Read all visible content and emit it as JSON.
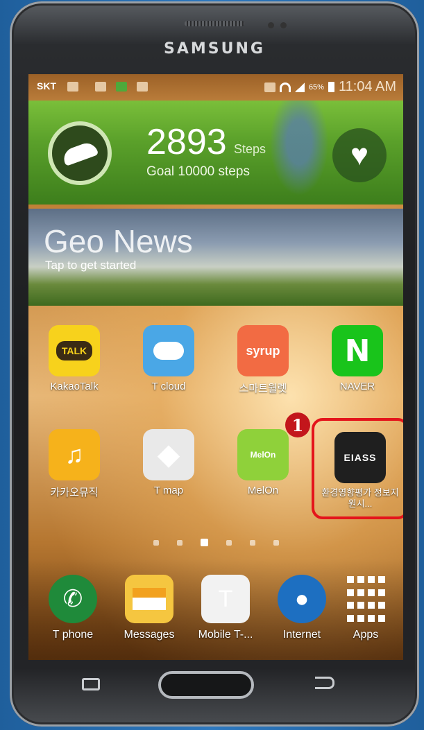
{
  "device": {
    "brand": "SAMSUNG"
  },
  "status_bar": {
    "carrier": "SKT",
    "battery": "65%",
    "time": "11:04 AM"
  },
  "health_widget": {
    "steps": "2893",
    "steps_unit": "Steps",
    "goal": "Goal 10000 steps"
  },
  "news_widget": {
    "title": "Geo News",
    "subtitle": "Tap to get started"
  },
  "home_apps": [
    {
      "label": "KakaoTalk",
      "icon": "kakaotalk-icon",
      "glyph": "TALK"
    },
    {
      "label": "T cloud",
      "icon": "tcloud-icon",
      "glyph": ""
    },
    {
      "label": "스마트월렛",
      "icon": "syrup-icon",
      "glyph": "syrup"
    },
    {
      "label": "NAVER",
      "icon": "naver-icon",
      "glyph": "N"
    },
    {
      "label": "카카오뮤직",
      "icon": "kakaomusic-icon",
      "glyph": "♫"
    },
    {
      "label": "T map",
      "icon": "tmap-icon",
      "glyph": "◆"
    },
    {
      "label": "MelOn",
      "icon": "melon-icon",
      "glyph": "MelOn"
    },
    {
      "label": "환경영향평가 정보지원시...",
      "icon": "eiass-icon",
      "glyph": "EIASS"
    }
  ],
  "step_marker": "1",
  "page_indicator": {
    "pages": 6,
    "active": 3
  },
  "dock": [
    {
      "label": "T phone",
      "icon": "phone-icon",
      "glyph": "✆"
    },
    {
      "label": "Messages",
      "icon": "messages-icon",
      "glyph": ""
    },
    {
      "label": "Mobile T-...",
      "icon": "mobile-tworld-icon",
      "glyph": "T"
    },
    {
      "label": "Internet",
      "icon": "globe-icon",
      "glyph": "🌐"
    },
    {
      "label": "Apps",
      "icon": "apps-grid-icon",
      "glyph": ""
    }
  ],
  "colors": {
    "highlight": "#e4141b",
    "marker": "#c3161c",
    "screen_gold": "#c9893d"
  }
}
